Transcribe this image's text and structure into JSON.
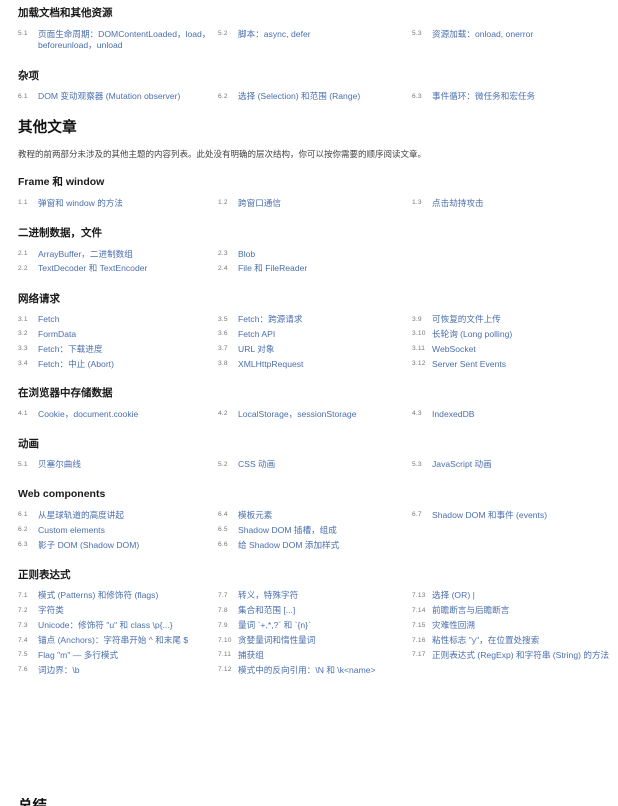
{
  "page": {
    "bottom_partial_heading": "总结"
  },
  "sections": [
    {
      "heading": "加载文档和其他资源",
      "columns": [
        [
          {
            "num": "5.1",
            "label": "页面生命周期：DOMContentLoaded，load，beforeunload，unload"
          }
        ],
        [
          {
            "num": "5.2",
            "label": "脚本：async, defer"
          }
        ],
        [
          {
            "num": "5.3",
            "label": "资源加载：onload, onerror"
          }
        ]
      ]
    },
    {
      "heading": "杂项",
      "columns": [
        [
          {
            "num": "6.1",
            "label": "DOM 变动观察器 (Mutation observer)"
          }
        ],
        [
          {
            "num": "6.2",
            "label": "选择 (Selection) 和范围 (Range)"
          }
        ],
        [
          {
            "num": "6.3",
            "label": "事件循环：微任务和宏任务"
          }
        ]
      ]
    }
  ],
  "other_articles": {
    "heading": "其他文章",
    "intro": "教程的前两部分未涉及的其他主题的内容列表。此处没有明确的层次结构，你可以按你需要的顺序阅读文章。",
    "sections": [
      {
        "heading": "Frame 和 window",
        "columns": [
          [
            {
              "num": "1.1",
              "label": "弹窗和 window 的方法"
            }
          ],
          [
            {
              "num": "1.2",
              "label": "跨窗口通信"
            }
          ],
          [
            {
              "num": "1.3",
              "label": "点击劫持攻击"
            }
          ]
        ]
      },
      {
        "heading": "二进制数据，文件",
        "columns": [
          [
            {
              "num": "2.1",
              "label": "ArrayBuffer，二进制数组"
            },
            {
              "num": "2.2",
              "label": "TextDecoder 和 TextEncoder"
            }
          ],
          [
            {
              "num": "2.3",
              "label": "Blob"
            },
            {
              "num": "2.4",
              "label": "File 和 FileReader"
            }
          ],
          []
        ]
      },
      {
        "heading": "网络请求",
        "columns": [
          [
            {
              "num": "3.1",
              "label": "Fetch"
            },
            {
              "num": "3.2",
              "label": "FormData"
            },
            {
              "num": "3.3",
              "label": "Fetch：下载进度"
            },
            {
              "num": "3.4",
              "label": "Fetch：中止 (Abort)"
            }
          ],
          [
            {
              "num": "3.5",
              "label": "Fetch：跨源请求"
            },
            {
              "num": "3.6",
              "label": "Fetch API"
            },
            {
              "num": "3.7",
              "label": "URL 对象"
            },
            {
              "num": "3.8",
              "label": "XMLHttpRequest"
            }
          ],
          [
            {
              "num": "3.9",
              "label": "可恢复的文件上传"
            },
            {
              "num": "3.10",
              "label": "长轮询 (Long polling)"
            },
            {
              "num": "3.11",
              "label": "WebSocket"
            },
            {
              "num": "3.12",
              "label": "Server Sent Events"
            }
          ]
        ]
      },
      {
        "heading": "在浏览器中存储数据",
        "columns": [
          [
            {
              "num": "4.1",
              "label": "Cookie，document.cookie"
            }
          ],
          [
            {
              "num": "4.2",
              "label": "LocalStorage，sessionStorage"
            }
          ],
          [
            {
              "num": "4.3",
              "label": "IndexedDB"
            }
          ]
        ]
      },
      {
        "heading": "动画",
        "columns": [
          [
            {
              "num": "5.1",
              "label": "贝塞尔曲线"
            }
          ],
          [
            {
              "num": "5.2",
              "label": "CSS 动画"
            }
          ],
          [
            {
              "num": "5.3",
              "label": "JavaScript 动画"
            }
          ]
        ]
      },
      {
        "heading": "Web components",
        "columns": [
          [
            {
              "num": "6.1",
              "label": "从星球轨道的高度讲起"
            },
            {
              "num": "6.2",
              "label": "Custom elements"
            },
            {
              "num": "6.3",
              "label": "影子 DOM (Shadow DOM)"
            }
          ],
          [
            {
              "num": "6.4",
              "label": "模板元素"
            },
            {
              "num": "6.5",
              "label": "Shadow DOM 插槽，组成"
            },
            {
              "num": "6.6",
              "label": "给 Shadow DOM 添加样式"
            }
          ],
          [
            {
              "num": "6.7",
              "label": "Shadow DOM 和事件 (events)"
            }
          ]
        ]
      },
      {
        "heading": "正则表达式",
        "columns": [
          [
            {
              "num": "7.1",
              "label": "模式 (Patterns) 和修饰符 (flags)"
            },
            {
              "num": "7.2",
              "label": "字符类"
            },
            {
              "num": "7.3",
              "label": "Unicode：修饰符 \"u\" 和 class \\p{...}"
            },
            {
              "num": "7.4",
              "label": "锚点 (Anchors)：字符串开始 ^ 和末尾 $"
            },
            {
              "num": "7.5",
              "label": "Flag \"m\" — 多行模式"
            },
            {
              "num": "7.6",
              "label": "词边界：\\b"
            }
          ],
          [
            {
              "num": "7.7",
              "label": "转义，特殊字符"
            },
            {
              "num": "7.8",
              "label": "集合和范围 [...]"
            },
            {
              "num": "7.9",
              "label": "量词 `+,*,?` 和 `{n}`"
            },
            {
              "num": "7.10",
              "label": "贪婪量词和惰性量词"
            },
            {
              "num": "7.11",
              "label": "捕获组"
            },
            {
              "num": "7.12",
              "label": "模式中的反向引用：\\N 和 \\k<name>"
            }
          ],
          [
            {
              "num": "7.13",
              "label": "选择 (OR) |"
            },
            {
              "num": "7.14",
              "label": "前瞻断言与后瞻断言"
            },
            {
              "num": "7.15",
              "label": "灾难性回溯"
            },
            {
              "num": "7.16",
              "label": "粘性标志 \"y\"，在位置处搜索"
            },
            {
              "num": "7.17",
              "label": "正则表达式 (RegExp) 和字符串 (String) 的方法"
            }
          ]
        ]
      }
    ]
  }
}
